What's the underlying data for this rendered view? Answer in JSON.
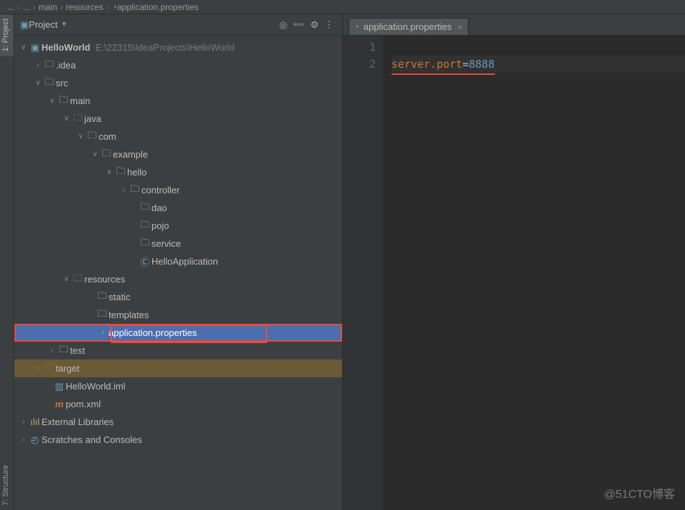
{
  "breadcrumb": {
    "parts": [
      "...",
      "...",
      "main",
      "resources"
    ],
    "final_icon": "spring-icon",
    "final": "application.properties"
  },
  "sidetabs": {
    "project": "1: Project",
    "structure": "7: Structure"
  },
  "panel": {
    "title": "Project",
    "icons": {
      "locate": "◎",
      "collapse": "➖",
      "settings": "⚙",
      "more": "⋮"
    }
  },
  "tree": {
    "root": {
      "name": "HelloWorld",
      "path": "E:\\22315\\IdeaProjects\\HelloWorld"
    },
    "idea": ".idea",
    "src": "src",
    "main": "main",
    "java": "java",
    "com": "com",
    "example": "example",
    "hello": "hello",
    "controller": "controller",
    "dao": "dao",
    "pojo": "pojo",
    "service": "service",
    "helloApp": "HelloApplication",
    "resources": "resources",
    "static": "static",
    "templates": "templates",
    "appProps": "application.properties",
    "test": "test",
    "target": "target",
    "iml": "HelloWorld.iml",
    "pom": "pom.xml",
    "ext": "External Libraries",
    "scratch": "Scratches and Consoles"
  },
  "editorTab": {
    "name": "application.properties"
  },
  "code": {
    "lines": [
      "1",
      "2"
    ],
    "l2_key": "server.port",
    "l2_eq": "=",
    "l2_val": "8888"
  },
  "watermark": "@51CTO博客"
}
